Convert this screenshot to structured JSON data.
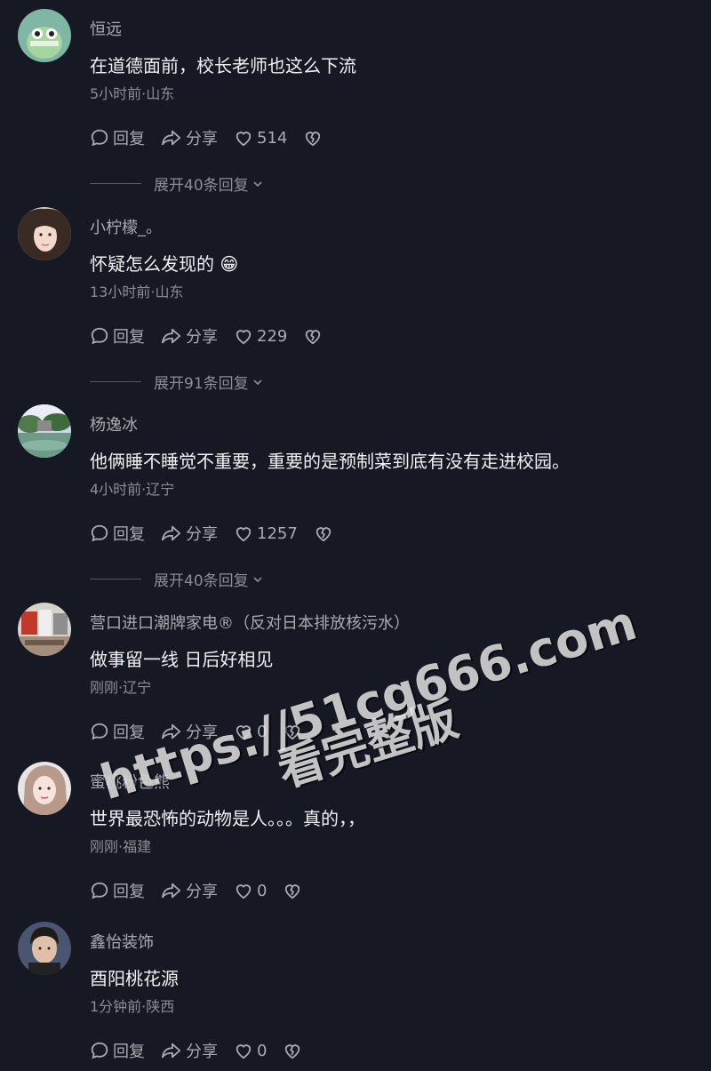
{
  "comments": [
    {
      "username": "恒远",
      "text": "在道德面前，校长老师也这么下流",
      "meta": "5小时前·山东",
      "reply_label": "回复",
      "share_label": "分享",
      "likes": "514",
      "expand_label": "展开40条回复"
    },
    {
      "username": "小柠檬_。",
      "text": "怀疑怎么发现的 😁",
      "meta": "13小时前·山东",
      "reply_label": "回复",
      "share_label": "分享",
      "likes": "229",
      "expand_label": "展开91条回复"
    },
    {
      "username": "杨逸冰",
      "text": "他俩睡不睡觉不重要，重要的是预制菜到底有没有走进校园。",
      "meta": "4小时前·辽宁",
      "reply_label": "回复",
      "share_label": "分享",
      "likes": "1257",
      "expand_label": "展开40条回复"
    },
    {
      "username": "营口进口潮牌家电®（反对日本排放核污水）",
      "text": "做事留一线 日后好相见",
      "meta": "刚刚·辽宁",
      "reply_label": "回复",
      "share_label": "分享",
      "likes": "0"
    },
    {
      "username": "蜜桃粉色熊",
      "text": "世界最恐怖的动物是人。。。真的，，",
      "meta": "刚刚·福建",
      "reply_label": "回复",
      "share_label": "分享",
      "likes": "0"
    },
    {
      "username": "鑫怡装饰",
      "text": "酉阳桃花源",
      "meta": "1分钟前·陕西",
      "reply_label": "回复",
      "share_label": "分享",
      "likes": "0"
    }
  ],
  "watermark": {
    "url": "https://51cg666.com",
    "caption": "看完整版"
  },
  "colors": {
    "background": "#161823",
    "username": "#a9aab0",
    "text": "#f0f0f2",
    "meta": "#8c8d94"
  },
  "icons": {
    "reply": "speech-bubble-icon",
    "share": "share-arrow-icon",
    "like": "heart-icon",
    "dislike": "broken-heart-icon",
    "expand": "chevron-down-icon"
  }
}
